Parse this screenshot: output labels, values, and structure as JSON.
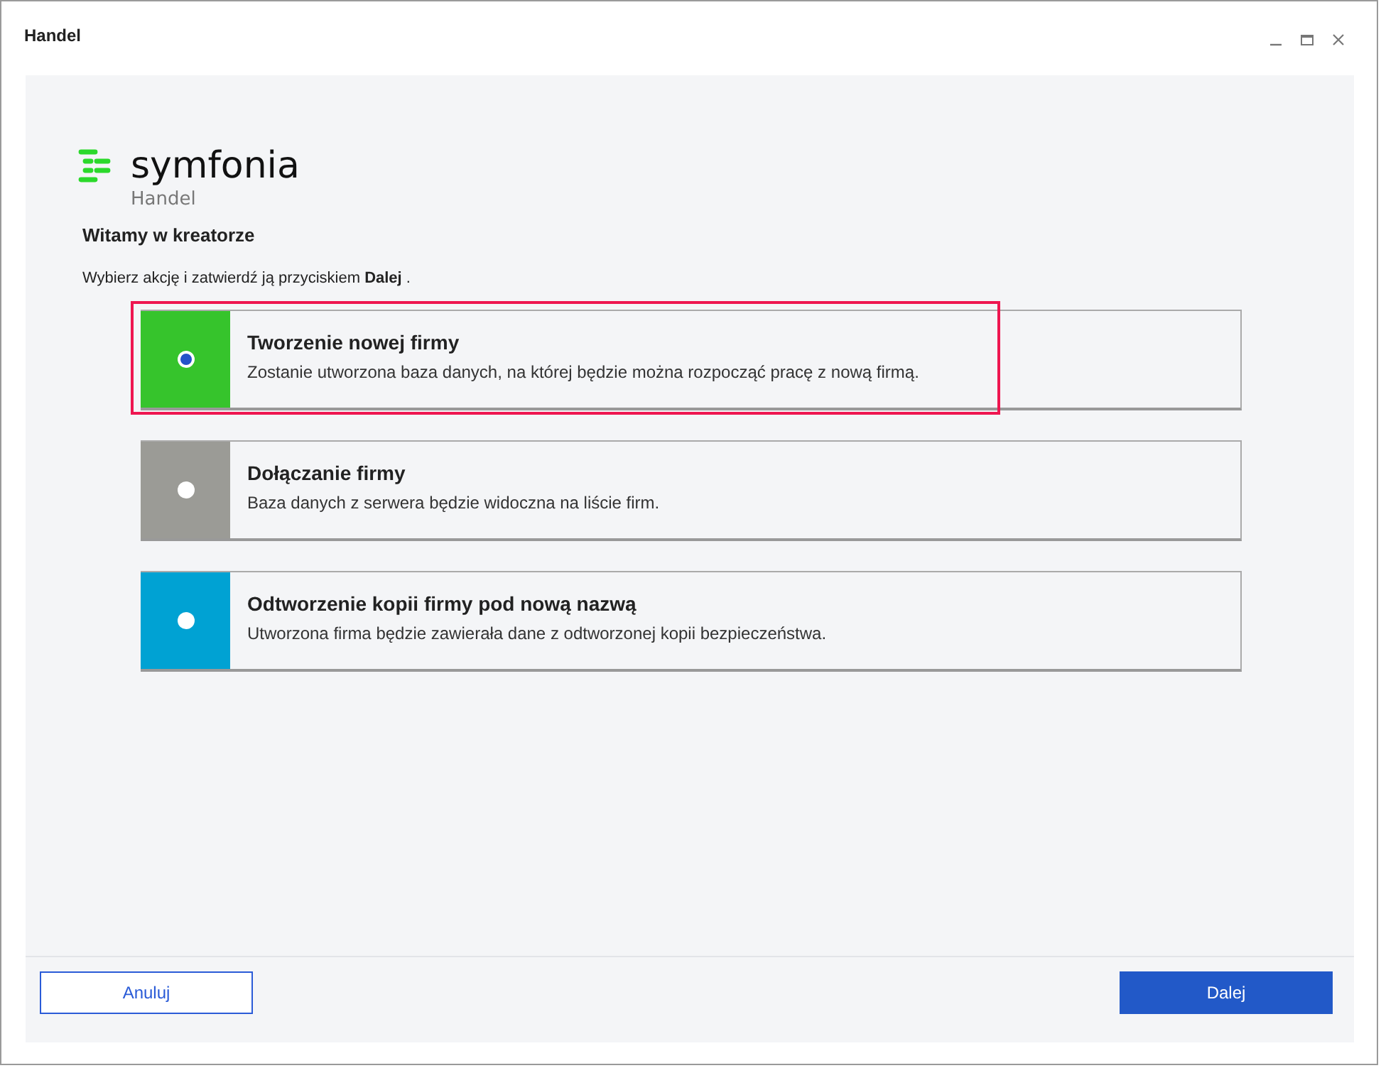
{
  "window": {
    "title": "Handel"
  },
  "logo": {
    "brand": "symfonia",
    "product": "Handel"
  },
  "heading": "Witamy w kreatorze",
  "instruction": "Wybierz akcję i zatwierdź ją przyciskiem **Dalej** .",
  "options": [
    {
      "title": "Tworzenie nowej firmy",
      "description": "Zostanie utworzona baza danych, na której będzie można rozpocząć pracę z nową firmą.",
      "color": "#36c42c",
      "selected": true
    },
    {
      "title": "Dołączanie firmy",
      "description": "Baza danych z serwera będzie widoczna na liście firm.",
      "color": "#9b9b96",
      "selected": false
    },
    {
      "title": "Odtworzenie kopii firmy pod nową nazwą",
      "description": "Utworzona firma będzie zawierała dane z odtworzonej kopii bezpieczeństwa.",
      "color": "#00a2d3",
      "selected": false
    }
  ],
  "buttons": [
    {
      "label": "Anuluj",
      "kind": "secondary"
    },
    {
      "label": "Dalej",
      "kind": "primary"
    }
  ]
}
